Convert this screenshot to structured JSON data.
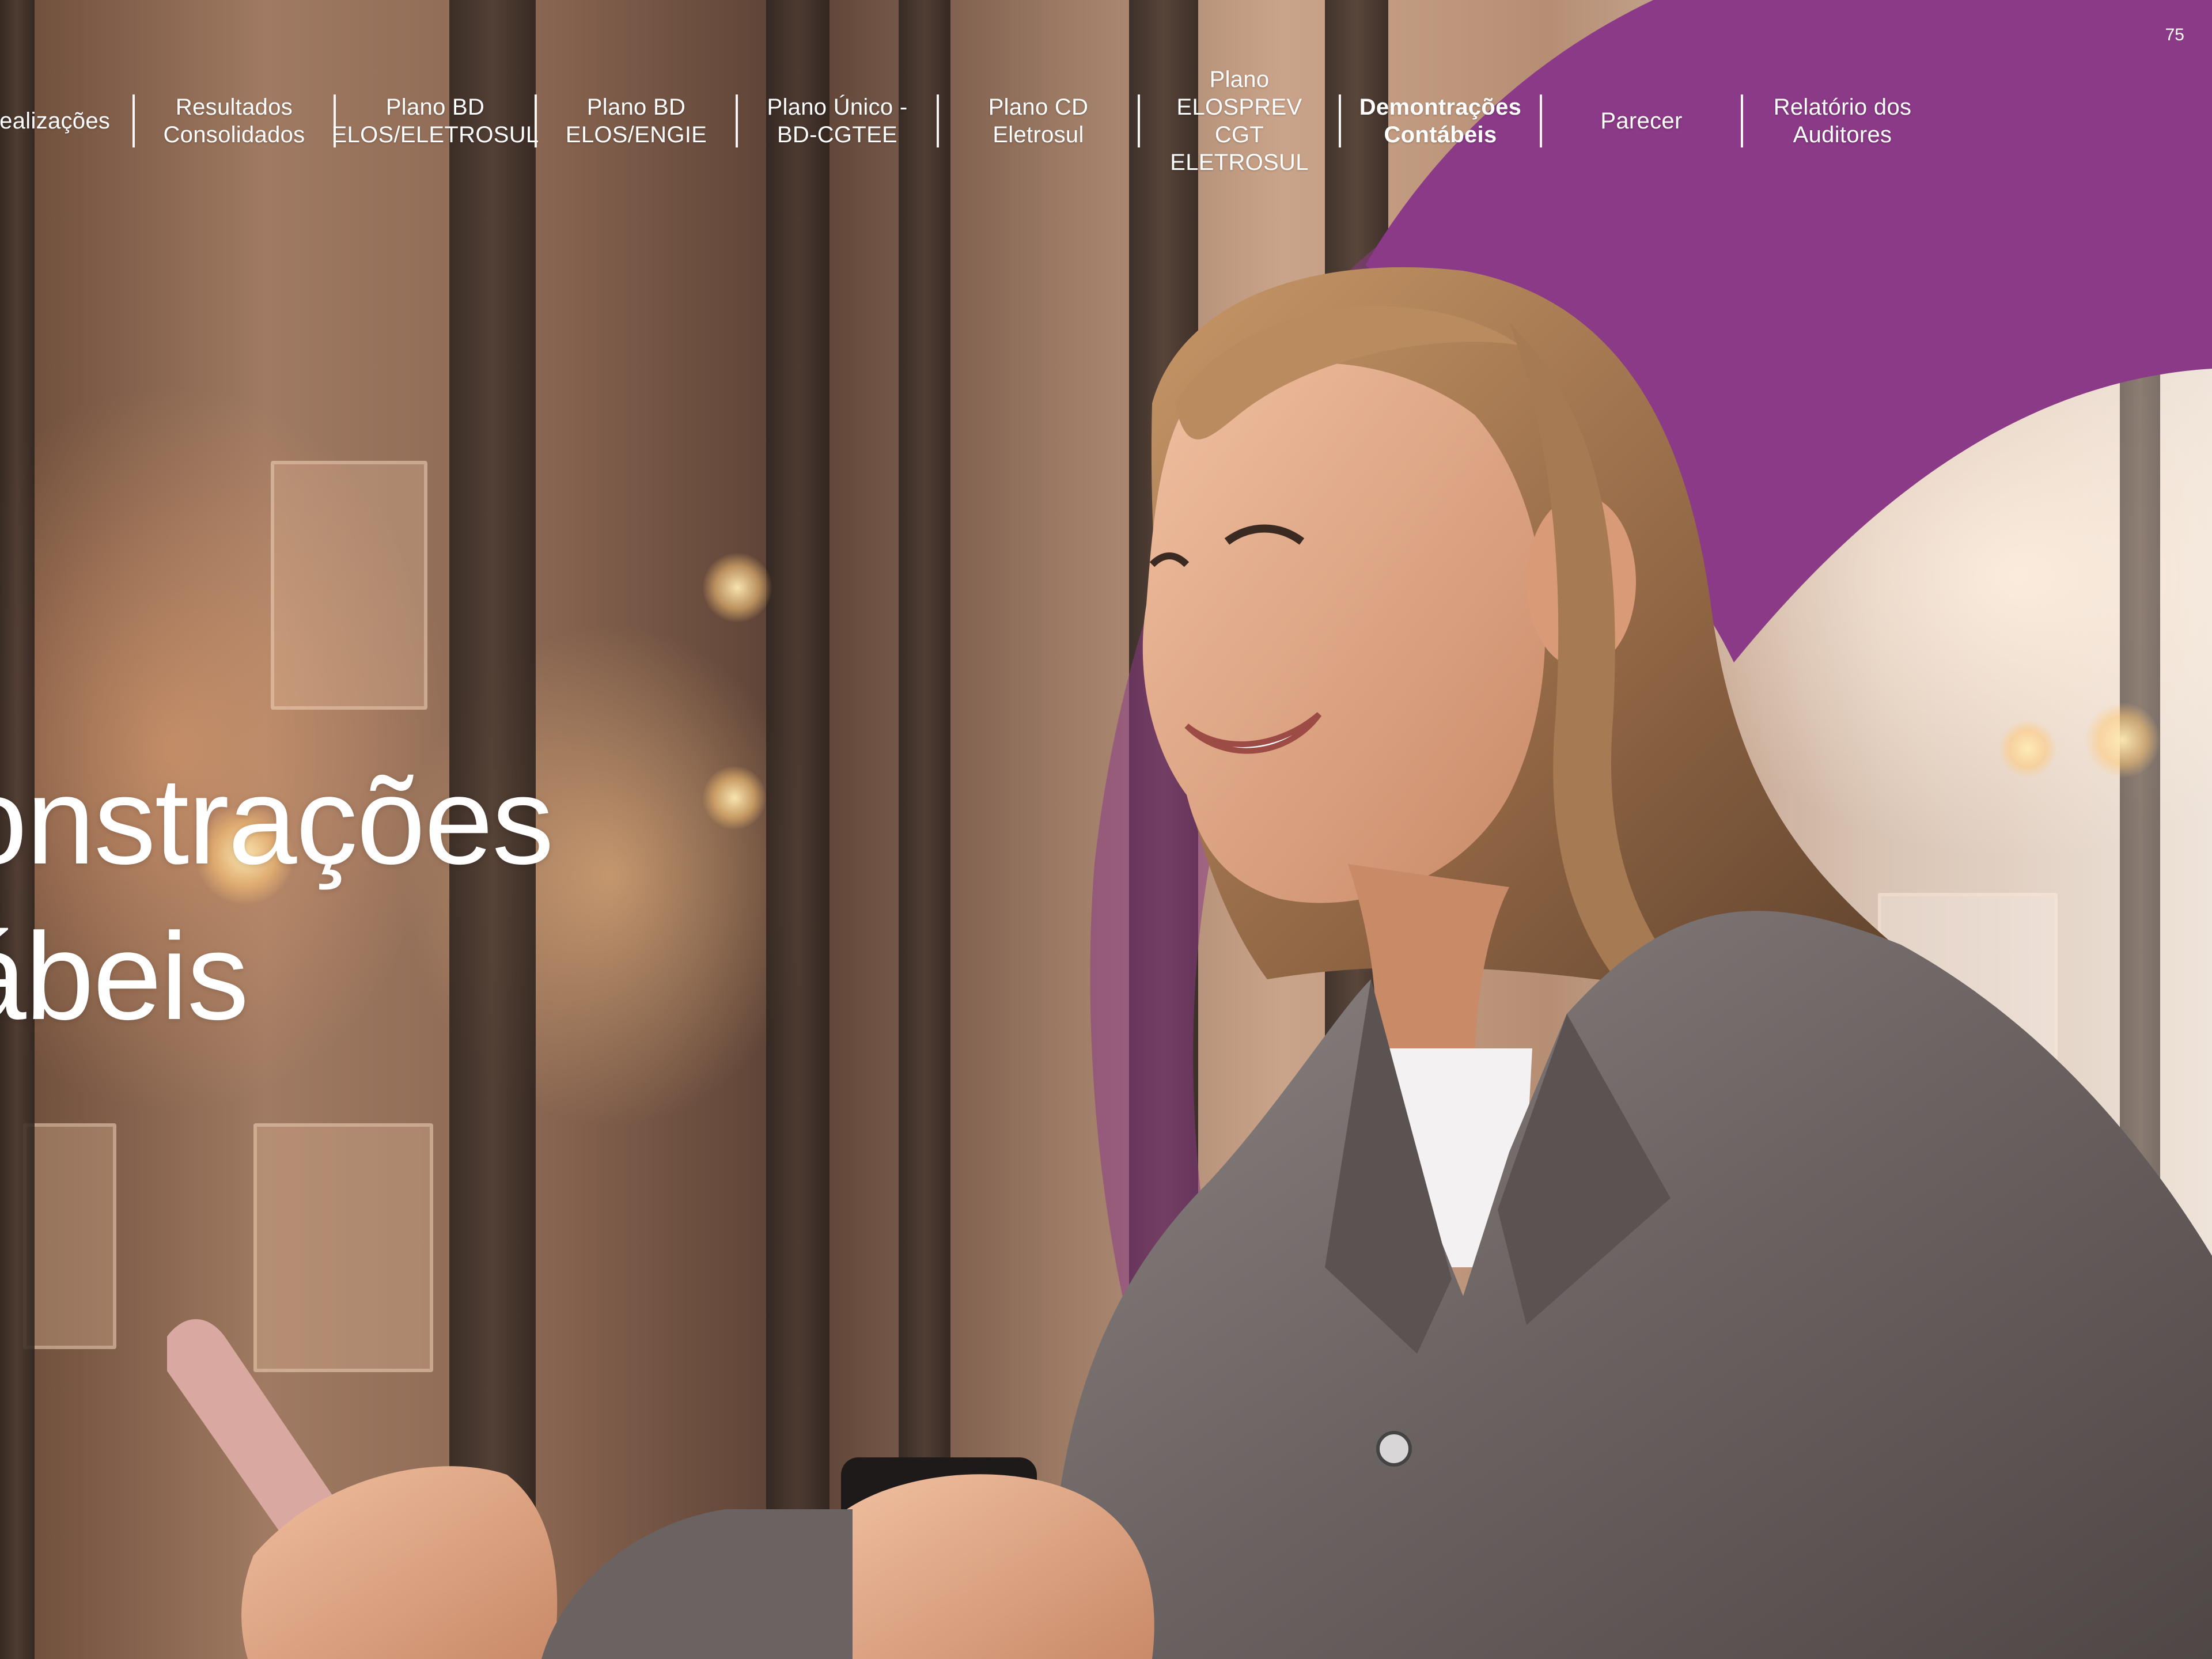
{
  "page": {
    "number": "75",
    "section_title": "Demonstrações\nContábeis"
  },
  "nav": {
    "items": [
      {
        "label": "Realizações",
        "active": false
      },
      {
        "label": "Resultados\nConsolidados",
        "active": false
      },
      {
        "label": "Plano BD\nELOS/ELETROSUL",
        "active": false
      },
      {
        "label": "Plano BD\nELOS/ENGIE",
        "active": false
      },
      {
        "label": "Plano Único -\nBD-CGTEE",
        "active": false
      },
      {
        "label": "Plano CD\nEletrosul",
        "active": false
      },
      {
        "label": "Plano ELOSPREV\nCGT ELETROSUL",
        "active": false
      },
      {
        "label": "Demontrações\nContábeis",
        "active": true
      },
      {
        "label": "Parecer",
        "active": false
      },
      {
        "label": "Relatório dos\nAuditores",
        "active": false
      }
    ]
  },
  "colors": {
    "brand_purple": "#8a3a86",
    "nav_text": "#ffffff"
  }
}
